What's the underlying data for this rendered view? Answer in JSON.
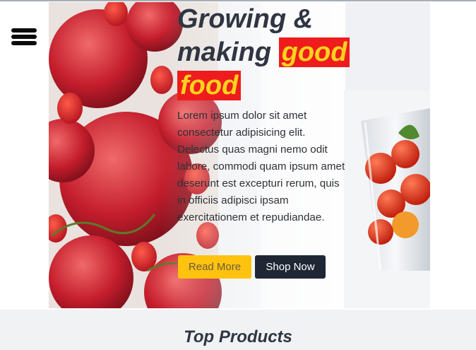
{
  "nav": {
    "menu_icon": "hamburger-menu-icon"
  },
  "hero": {
    "headline_plain": "Growing & making",
    "headline_highlight_1": "good",
    "headline_highlight_2": "food",
    "description": "Lorem ipsum dolor sit amet consectetur adipisicing elit. Delectus quas magni nemo odit labore, commodi quam ipsum amet deserunt est excepturi rerum, quis in officiis adipisci ipsam exercitationem et repudiandae.",
    "buttons": {
      "read_more": "Read More",
      "shop_now": "Shop Now"
    },
    "colors": {
      "highlight_bg": "#ee1c1c",
      "highlight_text": "#ffd21e",
      "read_more_bg": "#ffc30f",
      "shop_now_bg": "#1f2734"
    }
  },
  "products": {
    "section_title": "Top Products"
  }
}
